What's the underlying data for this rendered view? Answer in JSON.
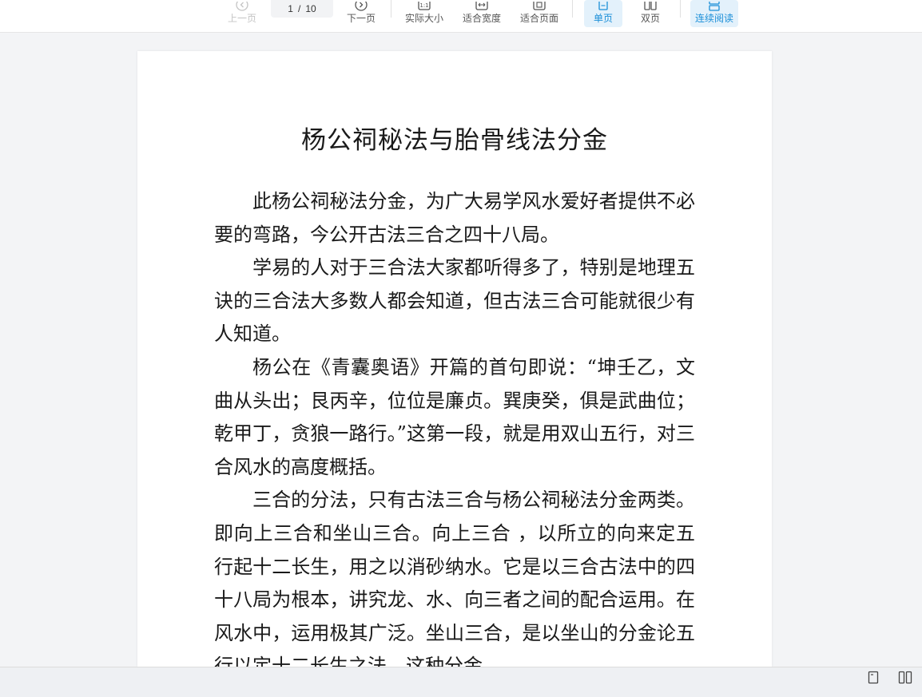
{
  "toolbar": {
    "prev_page": "上一页",
    "page_current": "1",
    "page_sep": "/",
    "page_total": "10",
    "next_page": "下一页",
    "actual_size": "实际大小",
    "fit_width": "适合宽度",
    "fit_page": "适合页面",
    "single_page": "单页",
    "double_page": "双页",
    "continuous_read": "连续阅读"
  },
  "colors": {
    "accent": "#1b8fd8",
    "active_bg": "#e3f1fb",
    "background": "#f3f4f6"
  },
  "document": {
    "title": "杨公祠秘法与胎骨线法分金",
    "paragraphs": [
      "此杨公祠秘法分金，为广大易学风水爱好者提供不必要的弯路，今公开古法三合之四十八局。",
      "学易的人对于三合法大家都听得多了，特别是地理五诀的三合法大多数人都会知道，但古法三合可能就很少有人知道。",
      "杨公在《青囊奥语》开篇的首句即说：“坤壬乙，文曲从头出；艮丙辛，位位是廉贞。巽庚癸，俱是武曲位；乾甲丁，贪狼一路行。”这第一段，就是用双山五行，对三合风水的高度概括。",
      "三合的分法，只有古法三合与杨公祠秘法分金两类。即向上三合和坐山三合。向上三合 ，以所立的向来定五行起十二长生，用之以消砂纳水。它是以三合古法中的四十八局为根本，讲究龙、水、向三者之间的配合运用。在风水中，运用极其广泛。坐山三合，是以坐山的分金论五行以定十二长生之法，这种分金"
    ]
  },
  "statusbar": {
    "icons": [
      "single-page-icon",
      "double-page-icon"
    ]
  }
}
